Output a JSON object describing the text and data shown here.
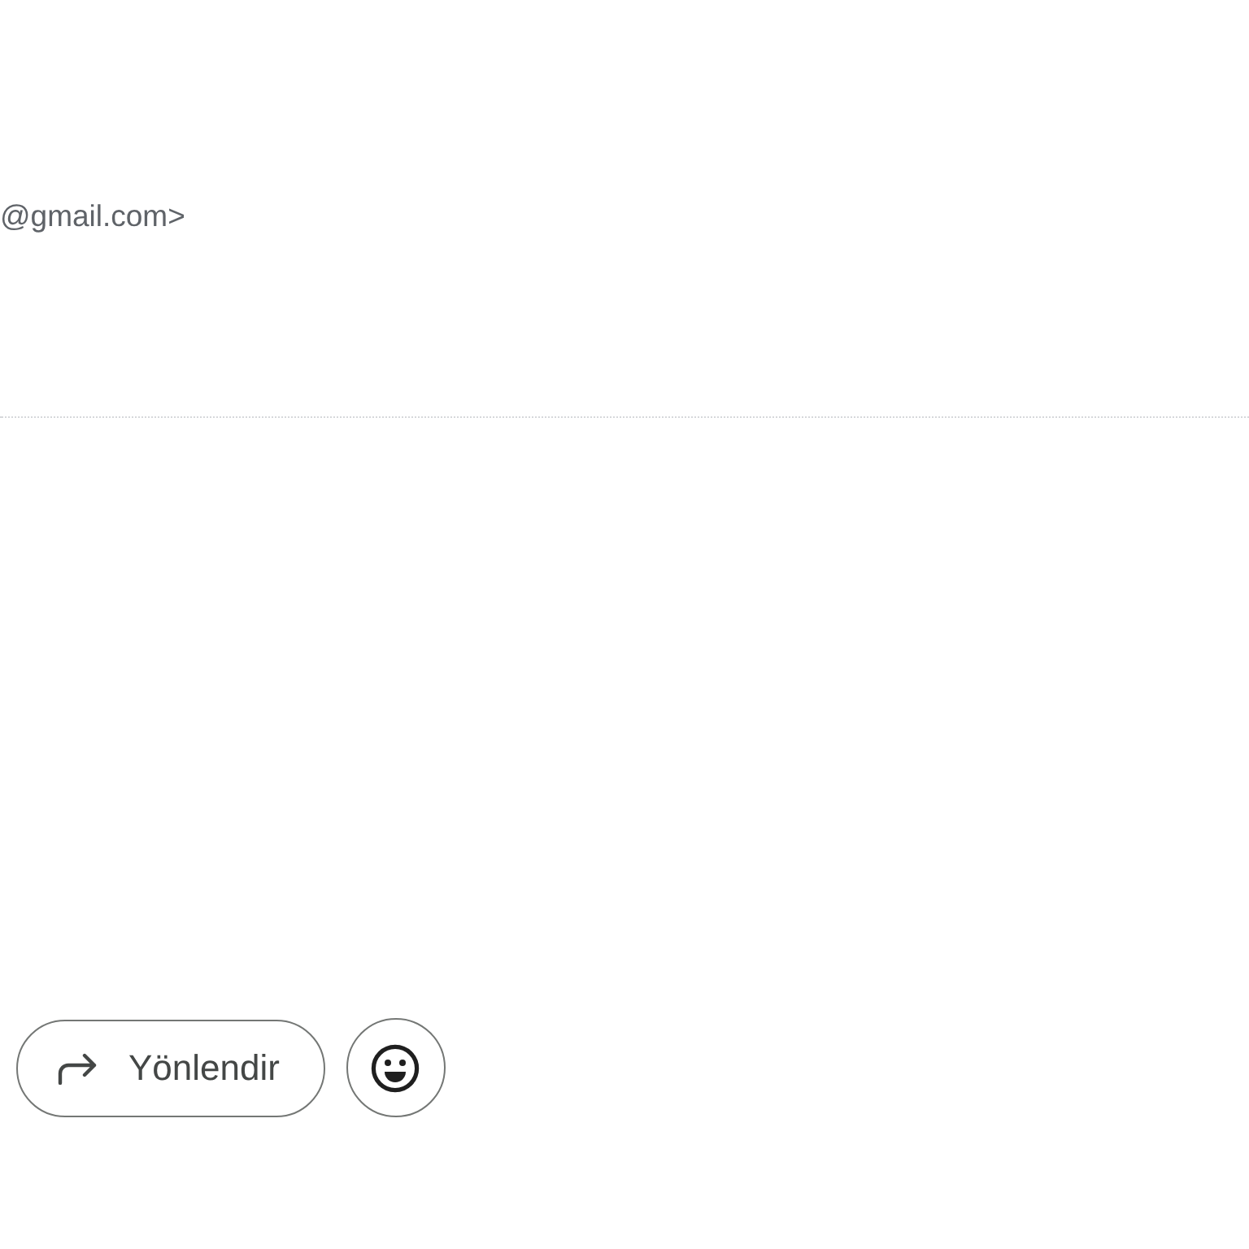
{
  "sender": {
    "address_fragment": "@gmail.com>"
  },
  "actions": [
    {
      "kind": "forward",
      "label": "Yönlendir"
    },
    {
      "kind": "emoji"
    }
  ]
}
